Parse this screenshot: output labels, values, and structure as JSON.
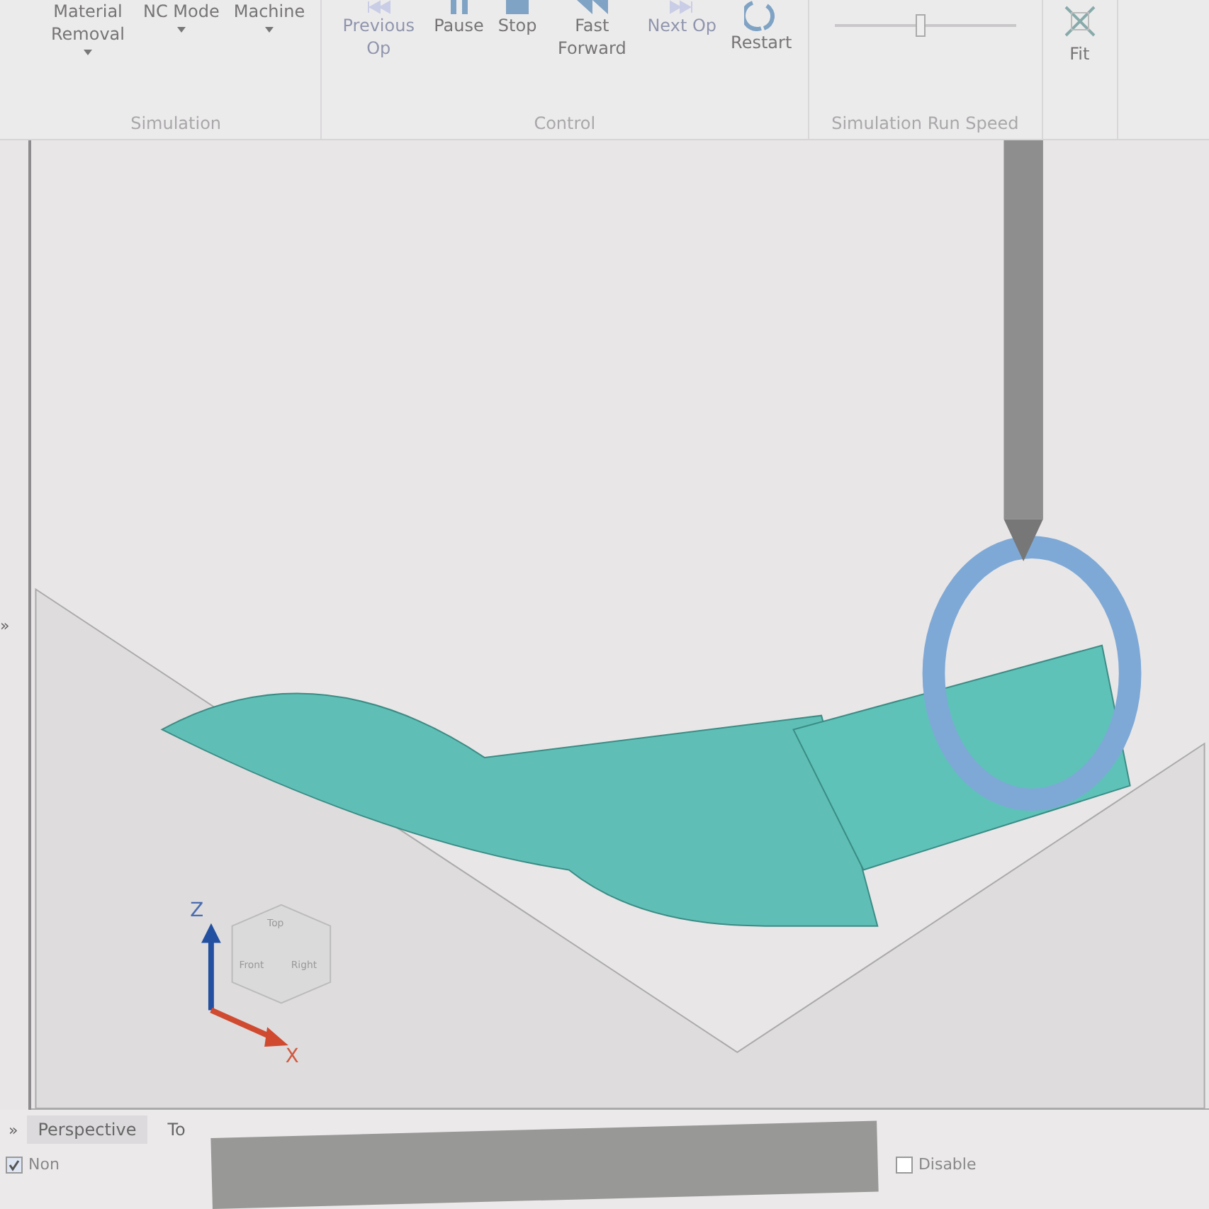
{
  "ribbon": {
    "groups": [
      {
        "label": "Simulation",
        "buttons": [
          {
            "label": "Material Removal",
            "dropdown": true,
            "disabled": false,
            "kind": "plain"
          },
          {
            "label": "NC Mode",
            "dropdown": true,
            "disabled": false,
            "kind": "plain"
          },
          {
            "label": "Machine",
            "dropdown": true,
            "disabled": false,
            "kind": "plain"
          }
        ]
      },
      {
        "label": "Control",
        "buttons": [
          {
            "label": "Previous Op",
            "dropdown": false,
            "disabled": true,
            "kind": "prev"
          },
          {
            "label": "Pause",
            "dropdown": false,
            "disabled": false,
            "kind": "pause"
          },
          {
            "label": "Stop",
            "dropdown": false,
            "disabled": false,
            "kind": "stop"
          },
          {
            "label": "Fast Forward",
            "dropdown": false,
            "disabled": false,
            "kind": "ff"
          },
          {
            "label": "Next Op",
            "dropdown": false,
            "disabled": true,
            "kind": "next"
          },
          {
            "label": "Restart",
            "dropdown": false,
            "disabled": false,
            "kind": "restart"
          }
        ]
      },
      {
        "label": "Simulation Run Speed",
        "slider": {
          "level": 0.45
        }
      },
      {
        "buttons": [
          {
            "label": "Fit",
            "dropdown": false,
            "disabled": false,
            "kind": "fit"
          }
        ]
      }
    ]
  },
  "viewport": {
    "axes": {
      "z": "Z",
      "x": "X"
    },
    "cube": {
      "top": "Top",
      "front": "Front",
      "right": "Right"
    }
  },
  "side_toggle": "»",
  "bottom_toggle": "»",
  "view_tabs": [
    {
      "label": "Perspective",
      "selected": true
    },
    {
      "label": "To",
      "selected": false
    }
  ],
  "options": [
    {
      "label": "Non",
      "checked": true
    },
    {
      "label": "Disable",
      "checked": false
    }
  ]
}
